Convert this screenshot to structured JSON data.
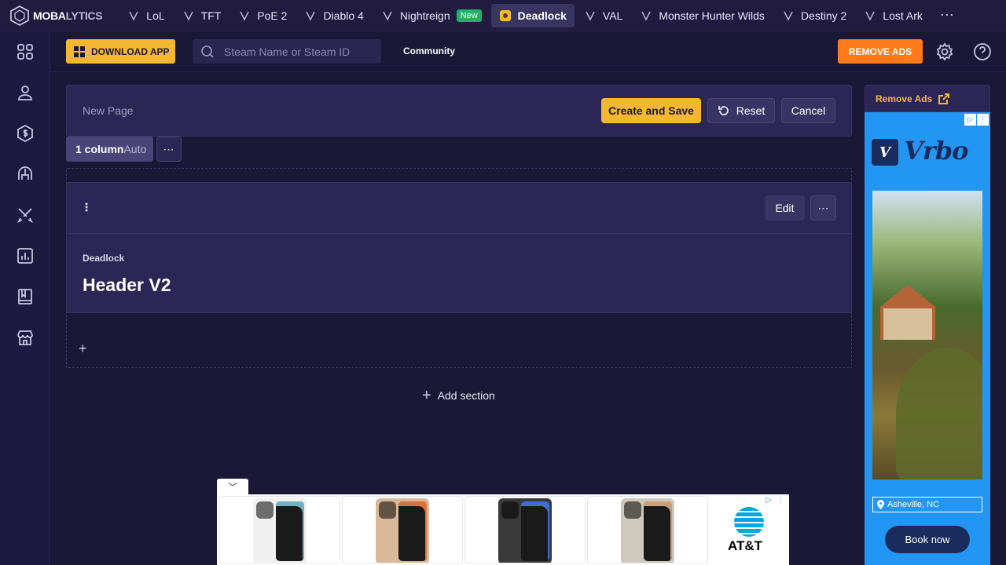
{
  "topnav": {
    "logo_main": "MOBA",
    "logo_dim": "LYTICS",
    "items": [
      {
        "label": "LoL",
        "icon": "lol-icon"
      },
      {
        "label": "TFT",
        "icon": "tft-icon"
      },
      {
        "label": "PoE 2",
        "icon": "poe2-icon"
      },
      {
        "label": "Diablo 4",
        "icon": "diablo4-icon"
      },
      {
        "label": "Nightreign",
        "icon": "nightreign-icon",
        "badge": "New"
      },
      {
        "label": "Deadlock",
        "icon": "deadlock-icon",
        "active": true
      },
      {
        "label": "VAL",
        "icon": "valorant-icon"
      },
      {
        "label": "Monster Hunter Wilds",
        "icon": "mhw-icon"
      },
      {
        "label": "Destiny 2",
        "icon": "destiny2-icon"
      },
      {
        "label": "Lost Ark",
        "icon": "lostark-icon"
      }
    ],
    "more": "⋯"
  },
  "header": {
    "download_label": "DOWNLOAD APP",
    "search_placeholder": "Steam Name or Steam ID",
    "community_label": "Community",
    "remove_ads_label": "REMOVE ADS"
  },
  "editor": {
    "page_title_placeholder": "New Page",
    "create_label": "Create and Save",
    "reset_label": "Reset",
    "cancel_label": "Cancel",
    "column_label": "1 column",
    "column_mode": "Auto",
    "more": "⋯"
  },
  "block": {
    "drag_handle": "⠇",
    "edit_label": "Edit",
    "more": "⋯",
    "kicker": "Deadlock",
    "heading": "Header V2"
  },
  "add_block": "+",
  "add_section": {
    "plus": "+",
    "label": "Add section"
  },
  "right_ad": {
    "remove_ads_label": "Remove Ads",
    "brand_mark": "V",
    "brand_word": "Vrbo",
    "location": "Asheville, NC",
    "cta": "Book now"
  },
  "bottom_ad": {
    "toggle": "﹀",
    "brand": "AT&T",
    "phone_colors": [
      "#f0f0f0",
      "#d9b99a",
      "#3a3a3a",
      "#cfc8bc"
    ],
    "phone_accents": [
      "#6fb3c2",
      "#e0703a",
      "#3f6fd0",
      "#c9a07a"
    ]
  },
  "colors": {
    "accent": "#f5b731",
    "remove_ads": "#ff7a19",
    "background": "#1b1737",
    "panel": "#2c2656"
  }
}
